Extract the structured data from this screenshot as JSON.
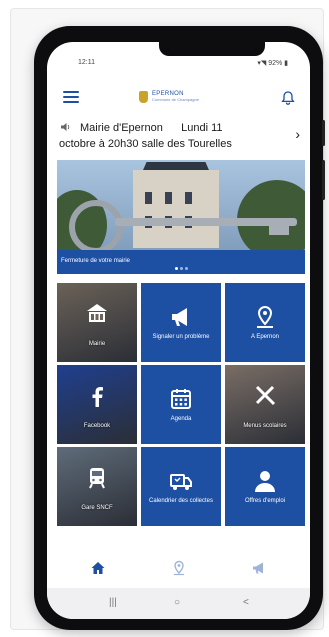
{
  "status_bar": {
    "time": "12:11",
    "right": "92%"
  },
  "header": {
    "logo_name": "EPERNON",
    "logo_sub": "Commune de Champagne"
  },
  "news_ticker": {
    "line1": "Mairie d'Epernon      Lundi 11",
    "line2": "octobre à 20h30 salle des Tourelles"
  },
  "hero": {
    "caption": "Fermeture de votre mairie",
    "slide_count": 3,
    "active_slide": 1
  },
  "tiles": [
    {
      "label": "Mairie",
      "kind": "photo",
      "icon": "town-hall-icon",
      "bg": "#6b6258"
    },
    {
      "label": "Signaler un problème",
      "kind": "blue",
      "icon": "megaphone-icon"
    },
    {
      "label": "A Epernon",
      "kind": "blue",
      "icon": "map-pin-icon"
    },
    {
      "label": "Facebook",
      "kind": "photo",
      "icon": "facebook-icon",
      "bg": "#1f3f8f"
    },
    {
      "label": "Agenda",
      "kind": "blue",
      "icon": "calendar-icon"
    },
    {
      "label": "Menus scolaires",
      "kind": "photo",
      "icon": "cutlery-icon",
      "bg": "#7a6e66"
    },
    {
      "label": "Gare SNCF",
      "kind": "photo",
      "icon": "train-icon",
      "bg": "#5f6c7a"
    },
    {
      "label": "Calendrier des collectes",
      "kind": "blue",
      "icon": "garbage-truck-icon"
    },
    {
      "label": "Offres d'emploi",
      "kind": "blue",
      "icon": "person-icon"
    }
  ],
  "bottom_nav": [
    {
      "icon": "home-icon",
      "active": true
    },
    {
      "icon": "map-pin-icon",
      "active": false
    },
    {
      "icon": "megaphone-icon",
      "active": false
    }
  ],
  "android_nav": {
    "recents": "|||",
    "home": "○",
    "back": "<"
  },
  "colors": {
    "primary": "#1d4fa3",
    "accent_gold": "#c9a227"
  }
}
